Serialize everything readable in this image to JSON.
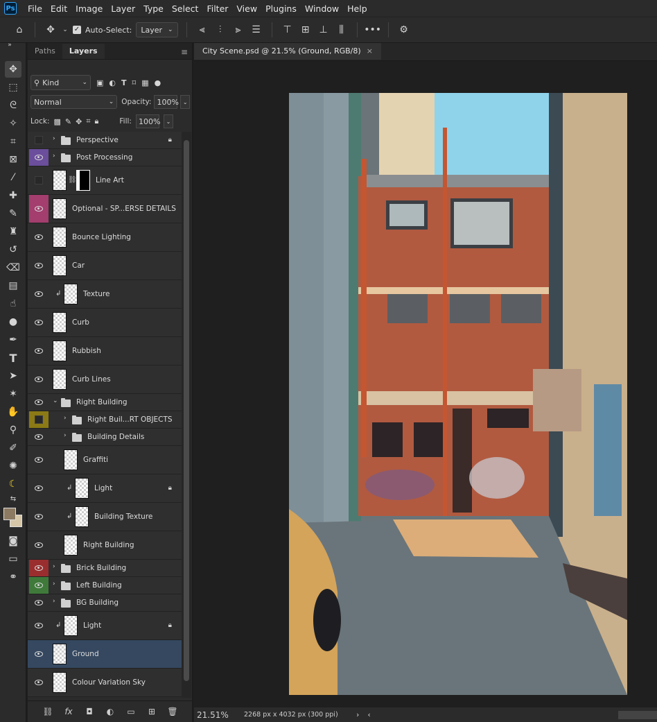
{
  "app": {
    "logo": "Ps"
  },
  "menu": [
    "File",
    "Edit",
    "Image",
    "Layer",
    "Type",
    "Select",
    "Filter",
    "View",
    "Plugins",
    "Window",
    "Help"
  ],
  "options": {
    "auto_select_label": "Auto-Select:",
    "auto_select_target": "Layer"
  },
  "layers_panel": {
    "tabs": [
      "Paths",
      "Layers"
    ],
    "filter_kind": "Kind",
    "blend_mode": "Normal",
    "opacity_label": "Opacity:",
    "opacity": "100%",
    "lock_label": "Lock:",
    "fill_label": "Fill:",
    "fill": "100%",
    "layers": [
      {
        "name": "Perspective",
        "type": "group",
        "visible": false,
        "color": "",
        "locked": true
      },
      {
        "name": "Post Processing",
        "type": "group",
        "visible": true,
        "color": "#6b4e9c"
      },
      {
        "name": "Line Art",
        "type": "masked",
        "visible": false,
        "color": ""
      },
      {
        "name": "Optional - SP...ERSE DETAILS",
        "type": "layer",
        "visible": true,
        "color": "#a33e6e"
      },
      {
        "name": "Bounce Lighting",
        "type": "layer",
        "visible": true,
        "color": ""
      },
      {
        "name": "Car",
        "type": "layer",
        "visible": true,
        "color": ""
      },
      {
        "name": "Texture",
        "type": "clipped",
        "visible": true,
        "color": ""
      },
      {
        "name": "Curb",
        "type": "layer",
        "visible": true,
        "color": ""
      },
      {
        "name": "Rubbish",
        "type": "layer",
        "visible": true,
        "color": ""
      },
      {
        "name": "Curb Lines",
        "type": "layer",
        "visible": true,
        "color": ""
      },
      {
        "name": "Right Building",
        "type": "group-open",
        "visible": true,
        "color": ""
      },
      {
        "name": "Right Buil...RT OBJECTS",
        "type": "subgroup",
        "visible": false,
        "color": "#8b7a15"
      },
      {
        "name": "Building Details",
        "type": "subgroup",
        "visible": true,
        "color": ""
      },
      {
        "name": "Graffiti",
        "type": "sublayer",
        "visible": true,
        "color": ""
      },
      {
        "name": "Light",
        "type": "subclipped",
        "visible": true,
        "color": "",
        "locked": true
      },
      {
        "name": "Building Texture",
        "type": "subclipped",
        "visible": true,
        "color": ""
      },
      {
        "name": "Right Building",
        "type": "sublayer",
        "visible": true,
        "color": ""
      },
      {
        "name": "Brick Building",
        "type": "group",
        "visible": true,
        "color": "#9a2e2e"
      },
      {
        "name": "Left Building",
        "type": "group",
        "visible": true,
        "color": "#3f7a3a"
      },
      {
        "name": "BG Building",
        "type": "group",
        "visible": true,
        "color": ""
      },
      {
        "name": "Light",
        "type": "clipped",
        "visible": true,
        "color": "",
        "locked": true
      },
      {
        "name": "Ground",
        "type": "layer",
        "visible": true,
        "color": "",
        "selected": true
      },
      {
        "name": "Colour Variation Sky",
        "type": "layer",
        "visible": true,
        "color": ""
      }
    ]
  },
  "document": {
    "tab_title": "City Scene.psd @ 21.5% (Ground, RGB/8)",
    "zoom": "21.51%",
    "info": "2268 px x 4032 px (300 ppi)"
  },
  "colors": {
    "foreground": "#8c7a62",
    "background": "#d6c7a8"
  }
}
